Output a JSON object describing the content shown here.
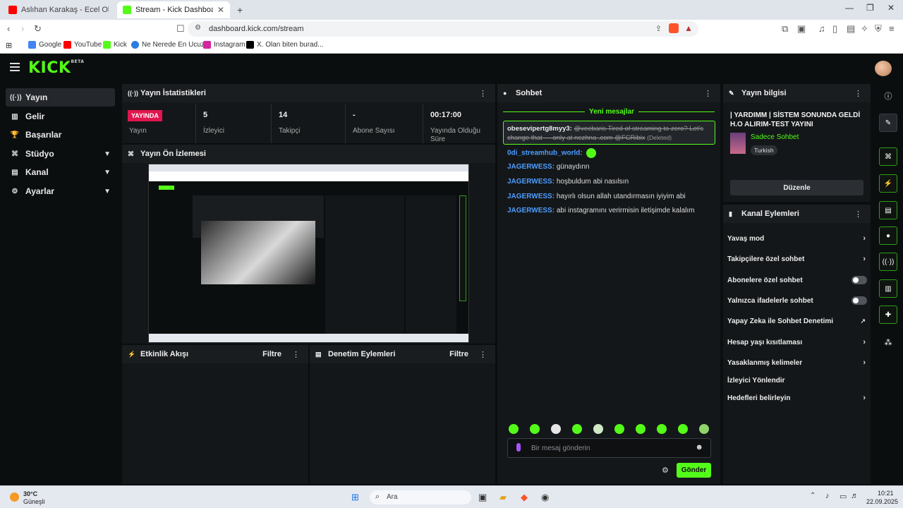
{
  "browser": {
    "tabs": [
      {
        "title": "Aslıhan Karakaş - Ecel Olsun (Re",
        "active": false
      },
      {
        "title": "Stream - Kick Dashboard",
        "active": true
      }
    ],
    "new_tab": "+",
    "url": "dashboard.kick.com/stream",
    "bookmarks": [
      "Google",
      "YouTube",
      "Kick",
      "Ne Nerede En Ucuz...",
      "Instagram",
      "X. Olan biten burad..."
    ]
  },
  "app": {
    "logo": "KICK",
    "logo_badge": "BETA",
    "accent": "#53fc18"
  },
  "sidebar": {
    "items": [
      {
        "label": "Yayın",
        "icon": "broadcast-icon",
        "active": true
      },
      {
        "label": "Gelir",
        "icon": "chart-icon"
      },
      {
        "label": "Başarılar",
        "icon": "trophy-icon"
      },
      {
        "label": "Stüdyo",
        "icon": "studio-icon",
        "expandable": true
      },
      {
        "label": "Kanal",
        "icon": "channel-icon",
        "expandable": true
      },
      {
        "label": "Ayarlar",
        "icon": "gear-icon",
        "expandable": true
      }
    ]
  },
  "stats": {
    "title": "Yayın İstatistikleri",
    "live_badge": "YAYINDA",
    "items": [
      {
        "value": "",
        "label": "Yayın"
      },
      {
        "value": "5",
        "label": "İzleyici"
      },
      {
        "value": "14",
        "label": "Takipçi"
      },
      {
        "value": "-",
        "label": "Abone Sayısı"
      },
      {
        "value": "00:17:00",
        "label": "Yayında Olduğu Süre"
      }
    ]
  },
  "preview": {
    "title": "Yayın Ön İzlemesi"
  },
  "activity": {
    "title": "Etkinlik Akışı",
    "filter": "Filtre"
  },
  "moderation": {
    "title": "Denetim Eylemleri",
    "filter": "Filtre"
  },
  "chat": {
    "title": "Sohbet",
    "new_messages": "Yeni mesajlar",
    "highlighted": {
      "user": "obesevipertg8myy3:",
      "text": "@veebaris Tired of streaming to zero? Let's change that — only at nezhna .com @FCRibix",
      "deleted": "(Deleted)"
    },
    "messages": [
      {
        "user": "0di_streamhub_world:",
        "text": ""
      },
      {
        "user": "JAGERWESS:",
        "text": "günaydınn"
      },
      {
        "user": "JAGERWESS:",
        "text": "hoşbuldum abi nasılsın"
      },
      {
        "user": "JAGERWESS:",
        "text": "hayırlı olsun allah utandırmasın iyiyim abi"
      },
      {
        "user": "JAGERWESS:",
        "text": "abi instagramını verirmisin iletişimde kalalım"
      }
    ],
    "placeholder": "Bir mesaj gönderin",
    "send": "Gönder"
  },
  "stream_info": {
    "title": "Yayın bilgisi",
    "stream_title": "| YARDIMM | SİSTEM SONUNDA GELDİ H.O ALIRIM-TEST YAYINI",
    "category": "Sadece Sohbet",
    "tag": "Turkish",
    "edit": "Düzenle"
  },
  "channel_actions": {
    "title": "Kanal Eylemleri",
    "items": [
      {
        "label": "Yavaş mod",
        "kind": "arrow"
      },
      {
        "label": "Takipçilere özel sohbet",
        "kind": "arrow"
      },
      {
        "label": "Abonelere özel sohbet",
        "kind": "toggle"
      },
      {
        "label": "Yalnızca ifadelerle sohbet",
        "kind": "toggle"
      },
      {
        "label": "Yapay Zeka ile Sohbet Denetimi",
        "kind": "external"
      },
      {
        "label": "Hesap yaşı kısıtlaması",
        "kind": "arrow"
      },
      {
        "label": "Yasaklanmış kelimeler",
        "kind": "arrow"
      },
      {
        "label": "İzleyici Yönlendir",
        "kind": "none"
      },
      {
        "label": "Hedefleri belirleyin",
        "kind": "arrow"
      }
    ]
  },
  "taskbar": {
    "weather_temp": "30°C",
    "weather_desc": "Güneşli",
    "search": "Ara",
    "time": "10:21",
    "date": "22.09.2025"
  }
}
